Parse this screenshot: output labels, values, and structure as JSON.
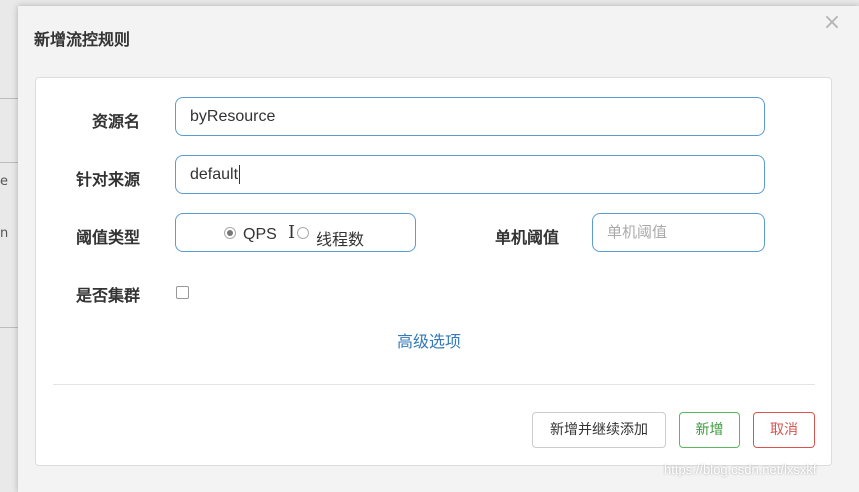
{
  "background": {
    "fragment_1": "e",
    "fragment_2": "n"
  },
  "dialog": {
    "title": "新增流控规则",
    "close_icon": "×"
  },
  "form": {
    "resource_label": "资源名",
    "resource_value": "byResource",
    "source_label": "针对来源",
    "source_value": "default",
    "threshold_type_label": "阈值类型",
    "threshold_options": [
      {
        "label": "QPS",
        "checked": true
      },
      {
        "label": "线程数",
        "checked": false
      }
    ],
    "single_threshold_label": "单机阈值",
    "single_threshold_placeholder": "单机阈值",
    "cluster_label": "是否集群",
    "advanced_link": "高级选项"
  },
  "buttons": {
    "add_continue": "新增并继续添加",
    "add": "新增",
    "cancel": "取消"
  },
  "watermark": "https://blog.csdn.net/lxsxkf",
  "colors": {
    "input_border": "#5c9bd1",
    "link": "#337ab7",
    "add_button": "#5cb85c",
    "cancel_button": "#d9534f"
  }
}
